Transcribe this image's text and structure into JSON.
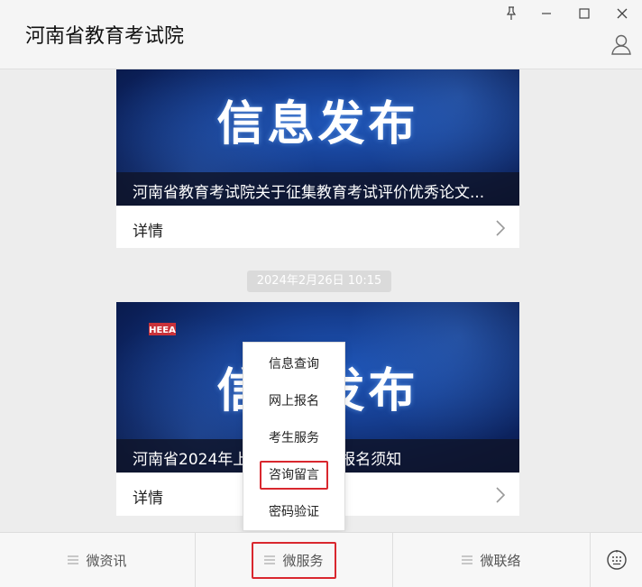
{
  "window": {
    "title": "河南省教育考试院",
    "controls": [
      "pin-icon",
      "minimize-icon",
      "maximize-icon",
      "close-icon"
    ]
  },
  "articles": [
    {
      "banner_text": "信息发布",
      "caption": "河南省教育考试院关于征集教育考试评价优秀论文...",
      "detail_label": "详情"
    },
    {
      "banner_text": "信息发布",
      "caption": "河南省2024年上半年自学考试报名须知",
      "detail_label": "详情",
      "logo": "HEEA"
    }
  ],
  "timestamp": "2024年2月26日 10:15",
  "popup_menu": {
    "items": [
      "信息查询",
      "网上报名",
      "考生服务",
      "咨询留言",
      "密码验证"
    ],
    "highlighted": "咨询留言"
  },
  "bottom_menu": {
    "items": [
      "微资讯",
      "微服务",
      "微联络"
    ],
    "highlighted": "微服务"
  },
  "colors": {
    "highlight_border": "#d9272e",
    "banner_blue": "#163f92",
    "background": "#ededed"
  }
}
